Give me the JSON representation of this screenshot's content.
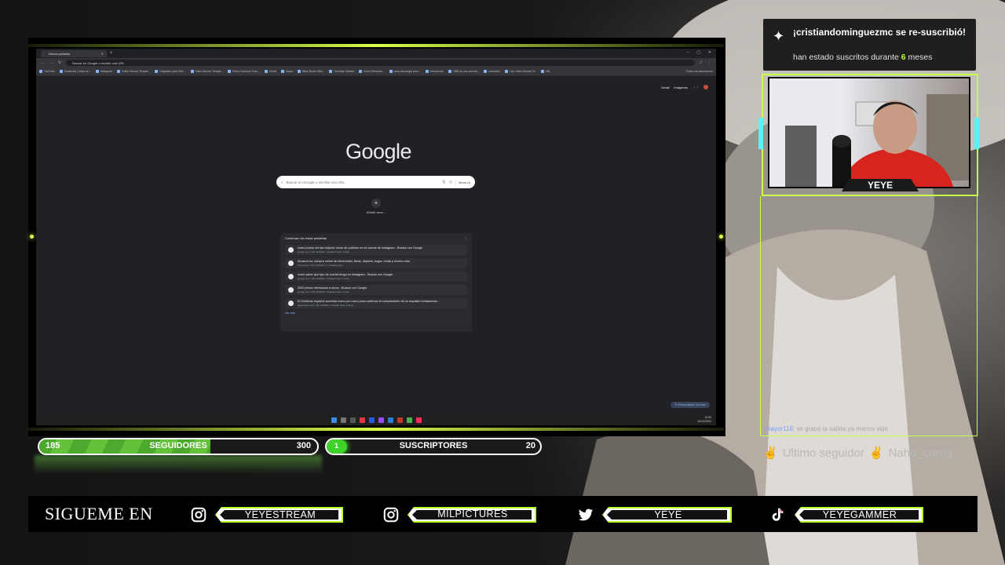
{
  "browser": {
    "tab_title": "Nueva pestaña",
    "omnibox_placeholder": "Buscar en Google o escribir una URL",
    "bookmarks": [
      "YouTube",
      "Facebook | Inicia se...",
      "Instagram",
      "Editor Mundo Templa...",
      "Ungesten para Stre...",
      "Video Mundo Templa...",
      "Fotos Overlays Fran...",
      "Gmail",
      "Mapa",
      "Mika Studio Nba...",
      "Overlays Stream",
      "Inicio Streamer...",
      "para descargar pres...",
      "bienvenido",
      "OBS es una una teh..",
      "nombres!",
      "Live Video Mundo Te..",
      "MIL"
    ],
    "bookmarks_right": "Todos los marcadores",
    "top_links": [
      "Gmail",
      "Imágenes"
    ],
    "logo": "Google",
    "search_placeholder": "Buscar en Google o escribir una URL",
    "ai_mode": "Modo IA",
    "shortcut_label": "Añadir acce...",
    "journeys_title": "Continuar con estas pestañas",
    "journeys": [
      {
        "title": "como puedo ver las mejores horas de publicar en mi cuenta de instagram - Buscar con Google",
        "sub": "google.com • Dic 20/2024 • Visitado hace 1 horas"
      },
      {
        "title": "Amazon.es: compra online de electrónica, libros, deporte, hogar, moda y mucho más.",
        "sub": "amazon.es • Dic 19/2024 • Lo visitaste ayer"
      },
      {
        "title": "como saber que tipo de cuenta tengo en instagram - Buscar con Google",
        "sub": "google.com • Dic 19/2024 • Visitado hace 1 horas"
      },
      {
        "title": "3200 pesos mexicanos a euros - Buscar con Google",
        "sub": "google.com • Dic 19/2024 • Visitado hace 1 horas"
      },
      {
        "title": "El Gobierno español aumenta como por como para confirmar el cumplimiento de un requisito fundamenta...",
        "sub": "elperiodico.com • Dic 18/2024 • Visitado hace 4 horas"
      }
    ],
    "journeys_more": "Ver más",
    "customize": "Personalizar Chrome",
    "tray_time": "13:53",
    "tray_date": "20/12/2024"
  },
  "alert": {
    "title": "¡cristiandominguezmc se re-suscribió!",
    "sub_prefix": "han estado suscritos durante",
    "months": "6",
    "sub_suffix": "meses"
  },
  "cam_tag": "YEYE",
  "chat": {
    "user": "mayor116",
    "text": "se grabó la salida ya menos vida"
  },
  "last_follower": {
    "label": "Ultimo seguidor",
    "name": "Nahu_carug"
  },
  "followers": {
    "current": "185",
    "label": "SEGUIDORES",
    "goal": "300",
    "progress": 0.617
  },
  "subs": {
    "label": "SUSCRIPTORES",
    "goal": "20",
    "current": "1"
  },
  "social": {
    "title": "SIGUEME EN",
    "items": [
      {
        "icon": "instagram-icon",
        "handle": "YEYESTREAM"
      },
      {
        "icon": "instagram-icon",
        "handle": "MILPICTURES"
      },
      {
        "icon": "twitter-icon",
        "handle": "YEYE"
      },
      {
        "icon": "tiktok-icon",
        "handle": "YEYEGAMMER"
      }
    ]
  },
  "colors": {
    "accent": "#c8ff4a",
    "follow_fill": "#5db935",
    "cyan": "#5ff0ff"
  }
}
